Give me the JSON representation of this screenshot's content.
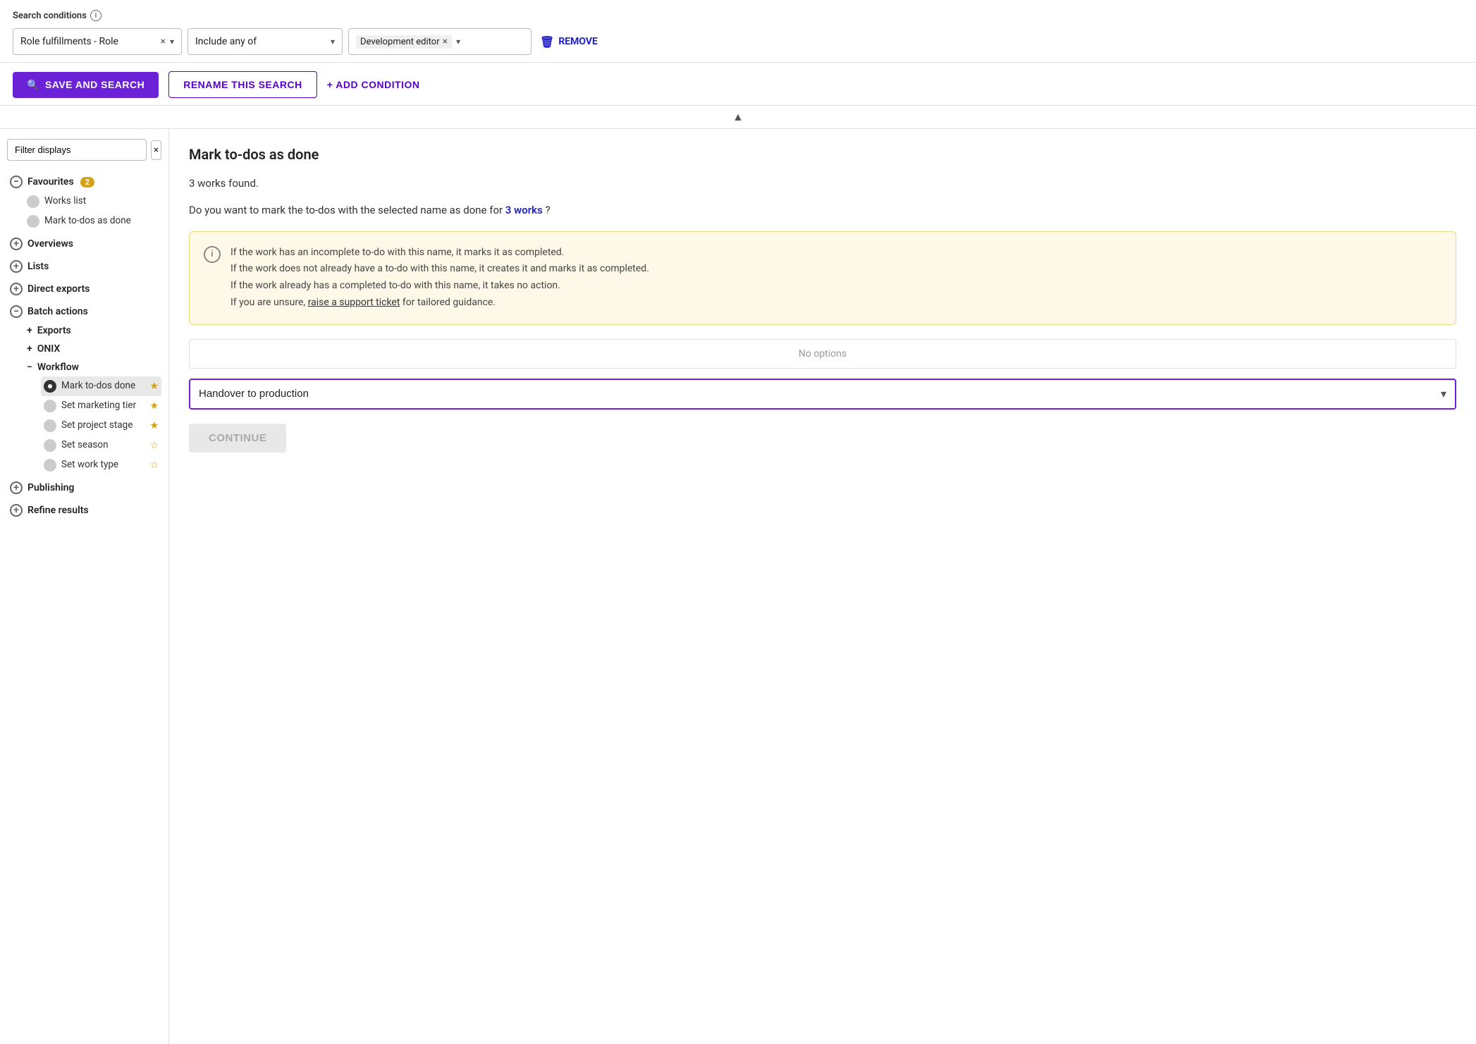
{
  "searchConditions": {
    "label": "Search conditions",
    "infoLabel": "i",
    "condition1": {
      "value": "Role fulfillments - Role",
      "clearBtn": "×",
      "chevron": "▾"
    },
    "condition2": {
      "value": "Include any of",
      "chevron": "▾"
    },
    "condition3": {
      "tagValue": "Development editor",
      "clearBtn": "×",
      "chevron": "▾"
    },
    "removeLabel": "REMOVE"
  },
  "actionButtons": {
    "saveAndSearch": "SAVE AND SEARCH",
    "renameThisSearch": "RENAME THIS SEARCH",
    "addCondition": "+ ADD CONDITION"
  },
  "sidebar": {
    "filterPlaceholder": "Filter displays",
    "clearBtn": "×",
    "sections": [
      {
        "id": "favourites",
        "label": "Favourites",
        "expanded": true,
        "badge": "2",
        "icon": "minus",
        "children": [
          {
            "id": "works-list",
            "label": "Works list",
            "active": false,
            "starred": false
          },
          {
            "id": "mark-todos-done",
            "label": "Mark to-dos as done",
            "active": true,
            "starred": true
          }
        ]
      },
      {
        "id": "overviews",
        "label": "Overviews",
        "expanded": false,
        "icon": "plus",
        "children": []
      },
      {
        "id": "lists",
        "label": "Lists",
        "expanded": false,
        "icon": "plus",
        "children": []
      },
      {
        "id": "direct-exports",
        "label": "Direct exports",
        "expanded": false,
        "icon": "plus",
        "children": []
      },
      {
        "id": "batch-actions",
        "label": "Batch actions",
        "expanded": true,
        "icon": "minus",
        "children": [],
        "subSections": [
          {
            "id": "exports",
            "label": "Exports",
            "expanded": false,
            "icon": "plus"
          },
          {
            "id": "onix",
            "label": "ONIX",
            "expanded": false,
            "icon": "plus"
          },
          {
            "id": "workflow",
            "label": "Workflow",
            "expanded": true,
            "icon": "minus",
            "children": [
              {
                "id": "mark-todos-done-2",
                "label": "Mark to-dos done",
                "active": true,
                "starred": true
              },
              {
                "id": "set-marketing-tier",
                "label": "Set marketing tier",
                "active": false,
                "starred": true
              },
              {
                "id": "set-project-stage",
                "label": "Set project stage",
                "active": false,
                "starred": true
              },
              {
                "id": "set-season",
                "label": "Set season",
                "active": false,
                "starred": false
              },
              {
                "id": "set-work-type",
                "label": "Set work type",
                "active": false,
                "starred": false
              }
            ]
          }
        ]
      },
      {
        "id": "publishing",
        "label": "Publishing",
        "expanded": false,
        "icon": "plus",
        "children": []
      },
      {
        "id": "refine-results",
        "label": "Refine results",
        "expanded": false,
        "icon": "plus",
        "children": []
      }
    ]
  },
  "contentPanel": {
    "title": "Mark to-dos as done",
    "worksFound": "3 works found.",
    "questionText": "Do you want to mark the to-dos with the selected name as done for",
    "worksLink": "3 works",
    "questionEnd": "?",
    "infoBox": {
      "lines": [
        "If the work has an incomplete to-do with this name, it marks it as completed.",
        "If the work does not already have a to-do with this name, it creates it and marks it as completed.",
        "If the work already has a completed to-do with this name, it takes no action.",
        "If you are unsure, raise a support ticket for tailored guidance."
      ],
      "linkText": "raise a support ticket"
    },
    "noOptions": "No options",
    "dropdownValue": "Handover to production",
    "continueBtn": "CONTINUE"
  }
}
